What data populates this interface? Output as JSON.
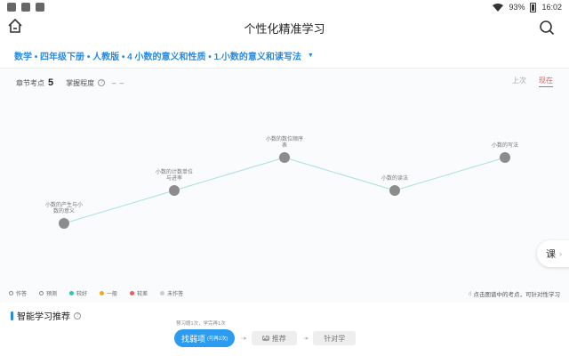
{
  "statusbar": {
    "battery": "93%",
    "time": "16:02"
  },
  "header": {
    "title": "个性化精准学习"
  },
  "breadcrumb": {
    "text": "数学 • 四年级下册 • 人教版 • 4 小数的意义和性质 • 1.小数的意义和读写法"
  },
  "stats": {
    "points_label": "章节考点",
    "points_value": "5",
    "mastery_label": "掌握程度",
    "mastery_value": "– –"
  },
  "time_toggle": {
    "prev": "上次",
    "now": "现在"
  },
  "map": {
    "nodes": [
      {
        "lines": [
          "小数的产生与小",
          "数的意义"
        ]
      },
      {
        "lines": [
          "小数的计数单位",
          "与进率"
        ]
      },
      {
        "lines": [
          "小数的数位顺序",
          "表"
        ]
      },
      {
        "lines": [
          "小数的读法"
        ]
      },
      {
        "lines": [
          "小数的写法"
        ]
      }
    ],
    "line_color": "#a8e0dc",
    "node_color": "#8c8c8c"
  },
  "course_button": {
    "label": "课"
  },
  "legend": [
    {
      "label": "作答",
      "style": "ring",
      "color": "#888888"
    },
    {
      "label": "预测",
      "style": "ring",
      "color": "#888888"
    },
    {
      "label": "较好",
      "style": "fill",
      "color": "#2ec4b6"
    },
    {
      "label": "一般",
      "style": "fill",
      "color": "#f5a623"
    },
    {
      "label": "较差",
      "style": "fill",
      "color": "#e85d5d"
    },
    {
      "label": "未作答",
      "style": "fill",
      "color": "#cccccc"
    }
  ],
  "tip": "点击图谱中的考点，可针对性学习",
  "recommend": {
    "title": "智能学习推荐",
    "subtitle": "预习题1次，学完再1次",
    "steps": [
      {
        "label": "找弱项",
        "note": "(可再2次)"
      },
      {
        "label": "推荐",
        "icon": "Ai"
      },
      {
        "label": "针对学"
      }
    ]
  }
}
